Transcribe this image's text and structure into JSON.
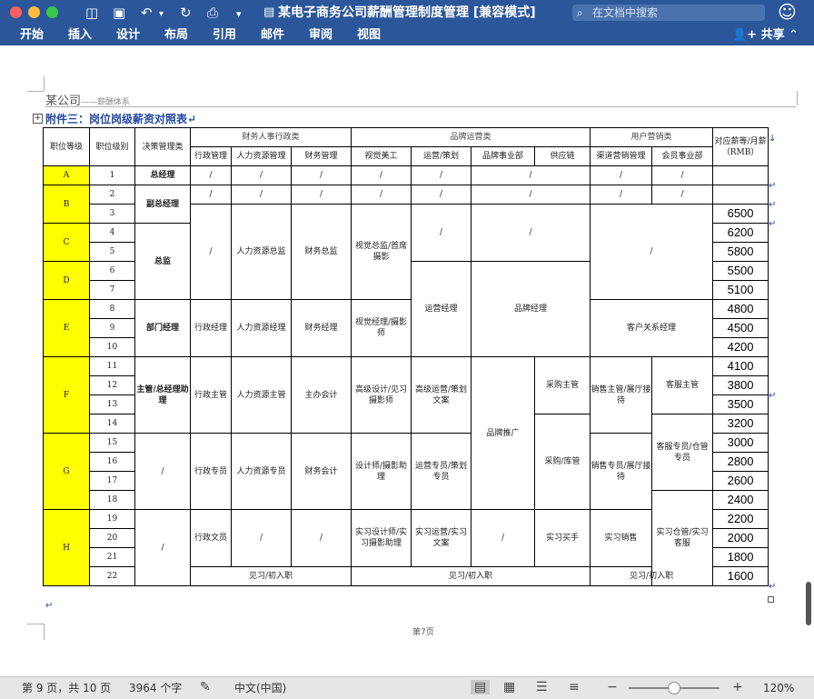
{
  "window": {
    "title": "某电子商务公司薪酬管理制度管理 [兼容模式]",
    "search_placeholder": "在文档中搜索"
  },
  "ribbon": {
    "tabs": [
      "开始",
      "插入",
      "设计",
      "布局",
      "引用",
      "邮件",
      "审阅",
      "视图"
    ],
    "share_label": "共享"
  },
  "document": {
    "header_company": "某公司",
    "header_sub": "——薪酬体系",
    "attachment_title": "附件三：岗位岗级薪资对照表",
    "footer_page": "第7页",
    "table": {
      "h_grade": "职位等级",
      "h_level": "职位级别",
      "h_decision": "决策管理类",
      "h_finance_group": "财务人事行政类",
      "h_brand_group": "品牌运营类",
      "h_user_group": "用户营销类",
      "h_salary": "对应薪等/月薪（RMB）",
      "h_admin": "行政管理",
      "h_hr": "人力资源管理",
      "h_finance": "财务管理",
      "h_visual": "视觉美工",
      "h_ops": "运营/策划",
      "h_brand_dept": "品牌事业部",
      "h_supply": "供应链",
      "h_channel": "渠道营销管理",
      "h_member": "会员事业部",
      "grades": [
        "A",
        "B",
        "C",
        "D",
        "E",
        "F",
        "G",
        "H"
      ],
      "levels": [
        "1",
        "2",
        "3",
        "4",
        "5",
        "6",
        "7",
        "8",
        "9",
        "10",
        "11",
        "12",
        "13",
        "14",
        "15",
        "16",
        "17",
        "18",
        "19",
        "20",
        "21",
        "22"
      ],
      "salaries": [
        "6500",
        "6200",
        "5800",
        "5500",
        "5100",
        "4800",
        "4500",
        "4200",
        "4100",
        "3800",
        "3500",
        "3200",
        "3000",
        "2800",
        "2600",
        "2400",
        "2200",
        "2000",
        "1800",
        "1600"
      ],
      "slash": "/",
      "gm": "总经理",
      "deputy_gm": "副总经理",
      "director": "总监",
      "hr_director": "人力资源总监",
      "finance_director": "财务总监",
      "visual_director": "视觉总监/首席摄影",
      "ops_manager": "运营经理",
      "brand_manager": "品牌经理",
      "dept_manager": "部门经理",
      "admin_manager": "行政经理",
      "hr_manager": "人力资源经理",
      "finance_manager": "财务经理",
      "visual_manager": "视觉经理/摄影师",
      "cust_manager": "客户关系经理",
      "supervisor": "主管/总经理助理",
      "admin_supervisor": "行政主管",
      "hr_supervisor": "人力资源主管",
      "chief_accountant": "主办会计",
      "senior_designer": "高级设计/见习摄影师",
      "senior_ops": "高级运营/策划文案",
      "brand_promotion": "品牌推广",
      "purchase_supervisor": "采购主管",
      "sales_supervisor": "销售主管/展厅接待",
      "cs_supervisor": "客服主管",
      "admin_specialist": "行政专员",
      "hr_specialist": "人力资源专员",
      "accountant": "财务会计",
      "designer": "设计师/摄影助理",
      "ops_specialist": "运营专员/策划专员",
      "purchase_warehouse": "采购/库管",
      "sales_specialist": "销售专员/展厅接待",
      "cs_specialist": "客服专员/仓管专员",
      "admin_clerk": "行政文员",
      "intern_designer": "实习设计师/实习摄影助理",
      "intern_ops": "实习运营/实习文案",
      "intern_buyer": "实习买手",
      "intern_sales": "实习销售",
      "intern_warehouse": "实习仓管/实习客服",
      "trainee": "见习/初入职"
    }
  },
  "statusbar": {
    "page_info": "第 9 页，共 10 页",
    "word_count": "3964 个字",
    "language": "中文(中国)",
    "zoom_percent": "120%",
    "zoom_fraction": 0.5
  }
}
